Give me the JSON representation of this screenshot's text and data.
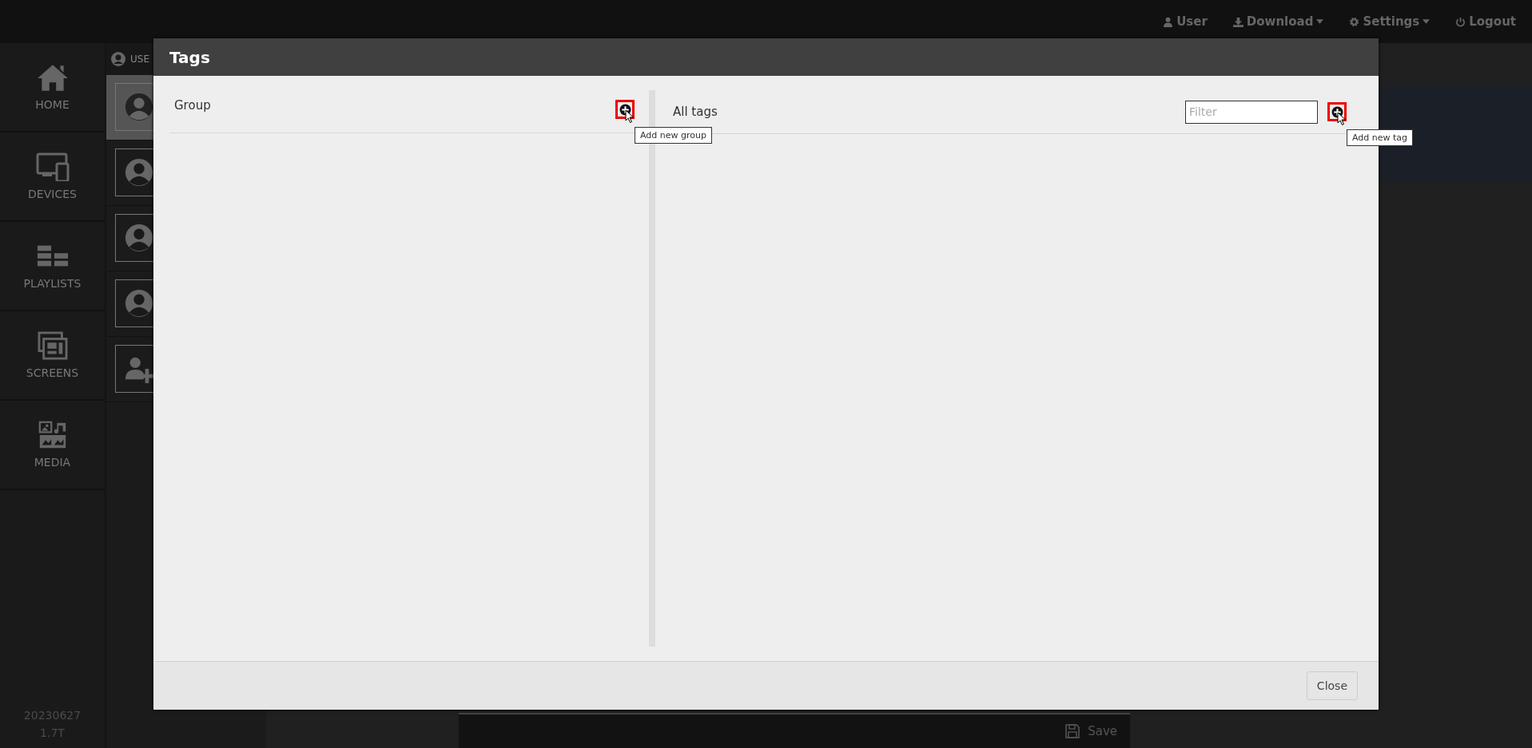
{
  "topbar": {
    "items": [
      {
        "label": "User",
        "kind": "user",
        "caret": false
      },
      {
        "label": "Download",
        "kind": "download",
        "caret": true
      },
      {
        "label": "Settings",
        "kind": "settings",
        "caret": true
      },
      {
        "label": "Logout",
        "kind": "logout",
        "caret": false
      }
    ]
  },
  "sidebar": {
    "items": [
      {
        "label": "HOME",
        "kind": "home"
      },
      {
        "label": "DEVICES",
        "kind": "devices"
      },
      {
        "label": "PLAYLISTS",
        "kind": "playlists"
      },
      {
        "label": "SCREENS",
        "kind": "screens"
      },
      {
        "label": "MEDIA",
        "kind": "media"
      }
    ],
    "version": "20230627",
    "build": "1.7T"
  },
  "users": {
    "header": "USE",
    "items": [
      {
        "kind": "user",
        "selected": true
      },
      {
        "kind": "user",
        "selected": false
      },
      {
        "kind": "user",
        "selected": false
      },
      {
        "kind": "user",
        "selected": false
      },
      {
        "kind": "add",
        "selected": false
      }
    ]
  },
  "save_bar": {
    "label": "Save"
  },
  "modal": {
    "title": "Tags",
    "group_panel": {
      "title": "Group",
      "add_button": {
        "highlighted": true,
        "tooltip": "Add new group"
      }
    },
    "tags_panel": {
      "title": "All tags",
      "filter": {
        "placeholder": "Filter"
      },
      "add_button": {
        "highlighted": true,
        "tooltip": "Add new tag"
      }
    },
    "buttons": [
      "Close"
    ]
  }
}
